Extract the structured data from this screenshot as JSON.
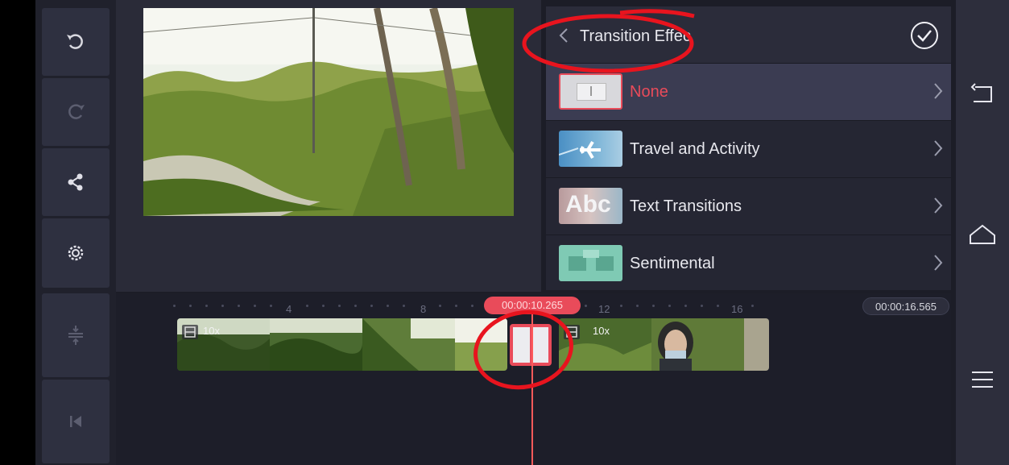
{
  "left_toolbar": {
    "buttons": [
      {
        "name": "undo",
        "icon": "undo-icon"
      },
      {
        "name": "redo",
        "icon": "redo-icon"
      },
      {
        "name": "share",
        "icon": "share-icon"
      },
      {
        "name": "settings",
        "icon": "gear-icon"
      },
      {
        "name": "adjust-layers",
        "icon": "layer-adjust-icon"
      },
      {
        "name": "skip-to-start",
        "icon": "skip-start-icon"
      }
    ]
  },
  "panel": {
    "title": "Transition Effec",
    "confirm_icon": "check-circle-icon",
    "items": [
      {
        "label": "None",
        "selected": true,
        "color": "#e94b5a"
      },
      {
        "label": "Travel and Activity",
        "selected": false
      },
      {
        "label": "Text Transitions",
        "selected": false,
        "thumb_text": "Abc"
      },
      {
        "label": "Sentimental",
        "selected": false
      }
    ]
  },
  "timeline": {
    "ruler": [
      "4",
      "8",
      "12",
      "16"
    ],
    "current_time": "00:00:10.265",
    "current_time_shown": "00:00:10.265",
    "total_time": "00:00:16.565",
    "clips": [
      {
        "speed": "10x"
      },
      {
        "speed": "10x"
      }
    ]
  },
  "system_nav": {
    "back": "back-icon",
    "home": "home-icon",
    "menu": "menu-icon"
  },
  "colors": {
    "accent": "#e94b5a",
    "playhead": "#ff5a5a",
    "selected_row": "#3b3c52"
  }
}
